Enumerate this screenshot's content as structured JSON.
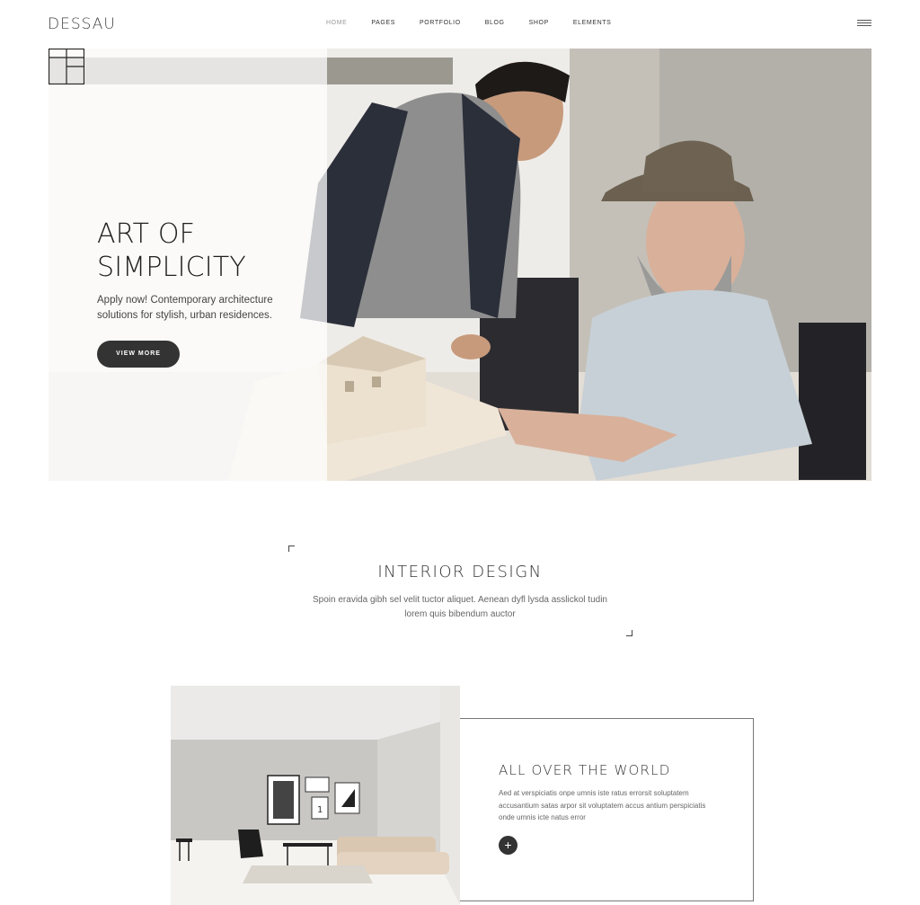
{
  "header": {
    "logo": "DESSAU",
    "nav": [
      "HOME",
      "PAGES",
      "PORTFOLIO",
      "BLOG",
      "SHOP",
      "ELEMENTS"
    ],
    "active_nav": "HOME",
    "menu_icon": "hamburger-icon"
  },
  "hero": {
    "title_line1": "ART OF",
    "title_line2": "SIMPLICITY",
    "text": "Apply now! Contemporary architecture solutions for stylish, urban residences.",
    "button_label": "VIEW MORE",
    "brand_icon": "layout-grid-icon"
  },
  "interior": {
    "title": "INTERIOR DESIGN",
    "text": "Spoin eravida gibh sel velit tuctor aliquet. Aenean dyfl lysda asslickol tudin lorem quis bibendum auctor"
  },
  "world_card": {
    "title": "ALL OVER THE WORLD",
    "text": "Aed at verspiciatis onpe umnis iste ratus errorsit soluptatem accusantium satas arpor sit voluptatem accus antium perspiciatis onde umnis icte natus error",
    "plus_icon": "plus-icon"
  },
  "colors": {
    "accent": "#333333",
    "background": "#ffffff"
  }
}
